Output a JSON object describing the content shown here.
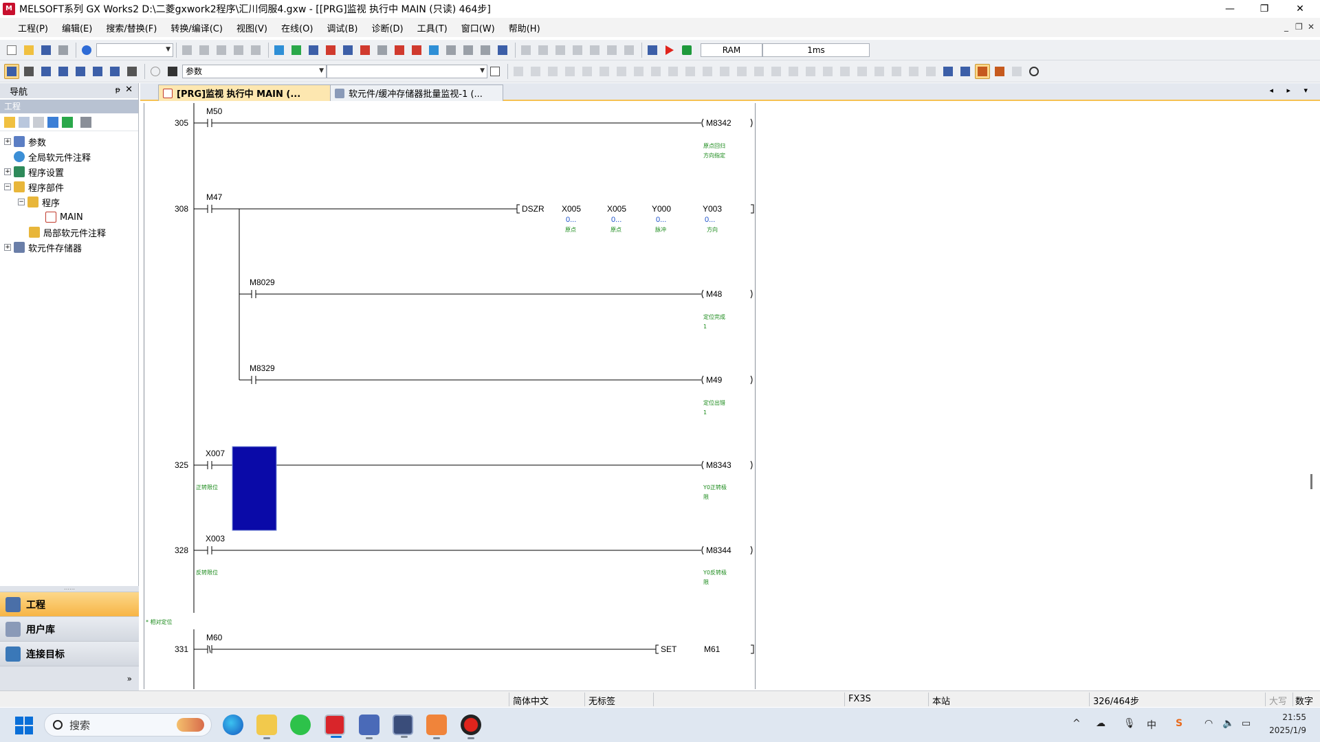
{
  "window": {
    "title": "MELSOFT系列 GX Works2 D:\\二菱gxwork2程序\\汇川伺服4.gxw - [[PRG]监视 执行中 MAIN (只读) 464步]",
    "minimize": "—",
    "restore": "❐",
    "close": "✕"
  },
  "menu": {
    "items": [
      "工程(P)",
      "编辑(E)",
      "搜索/替换(F)",
      "转换/编译(C)",
      "视图(V)",
      "在线(O)",
      "调试(B)",
      "诊断(D)",
      "工具(T)",
      "窗口(W)",
      "帮助(H)"
    ],
    "mdi_min": "_",
    "mdi_restore": "❐",
    "mdi_close": "✕"
  },
  "toolbar": {
    "memory_label": "RAM",
    "scan_time": "1ms",
    "param_combo": "参数"
  },
  "nav": {
    "header": "导航",
    "pin": "ᵽ",
    "close": "✕",
    "section": "工程",
    "tree": [
      {
        "label": "参数",
        "exp": "+"
      },
      {
        "label": "全局软元件注释",
        "exp": ""
      },
      {
        "label": "程序设置",
        "exp": "+"
      },
      {
        "label": "程序部件",
        "exp": "−"
      },
      {
        "label": "程序",
        "exp": "−"
      },
      {
        "label": "MAIN",
        "exp": ""
      },
      {
        "label": "局部软元件注释",
        "exp": ""
      },
      {
        "label": "软元件存储器",
        "exp": "+"
      }
    ],
    "grip": "……",
    "tabs": [
      "工程",
      "用户库",
      "连接目标"
    ],
    "more": "»"
  },
  "doc_tabs": {
    "active": "[PRG]监视 执行中 MAIN (...",
    "active_close": "✕",
    "second": "软元件/缓冲存储器批量监视-1 (...",
    "nav": "◂ ▸ ▾"
  },
  "ladder": {
    "rungs": [
      {
        "step": "305",
        "contact": "M50",
        "coil": "M8342",
        "coil_comment": [
          "原点回归",
          "方向指定"
        ]
      },
      {
        "step": "308",
        "contact": "M47",
        "instr": "DSZR",
        "operands": [
          {
            "name": "X005",
            "val": "0...",
            "cmt": "原点"
          },
          {
            "name": "X005",
            "val": "0...",
            "cmt": "原点"
          },
          {
            "name": "Y000",
            "val": "0...",
            "cmt": "脉冲"
          },
          {
            "name": "Y003",
            "val": "0...",
            "cmt": "方向"
          }
        ]
      },
      {
        "contact": "M8029",
        "coil": "M48",
        "coil_comment": [
          "定位完成",
          "1"
        ]
      },
      {
        "contact": "M8329",
        "coil": "M49",
        "coil_comment": [
          "定位出错",
          "1"
        ]
      },
      {
        "step": "325",
        "contact": "X007",
        "contact_comment": "正转限位",
        "coil": "M8343",
        "coil_comment": [
          "Y0正转极",
          "限"
        ]
      },
      {
        "step": "328",
        "contact": "X003",
        "contact_comment": "反转限位",
        "coil": "M8344",
        "coil_comment": [
          "Y0反转极",
          "限"
        ]
      },
      {
        "step": "331",
        "contact": "M60",
        "instr": "SET",
        "operand": "M61"
      }
    ],
    "statement": "* 相对定位"
  },
  "status": {
    "language": "简体中文",
    "label": "无标签",
    "cpu": "FX3S",
    "station": "本站",
    "steps": "326/464步",
    "caps": "大写",
    "num": "数字"
  },
  "taskbar": {
    "search": "搜索",
    "time": "21:55",
    "date": "2025/1/9"
  },
  "colors": {
    "accent_tab": "#f7b545",
    "cursor": "#0a0aa8",
    "comment_green": "#1a8a1a"
  }
}
